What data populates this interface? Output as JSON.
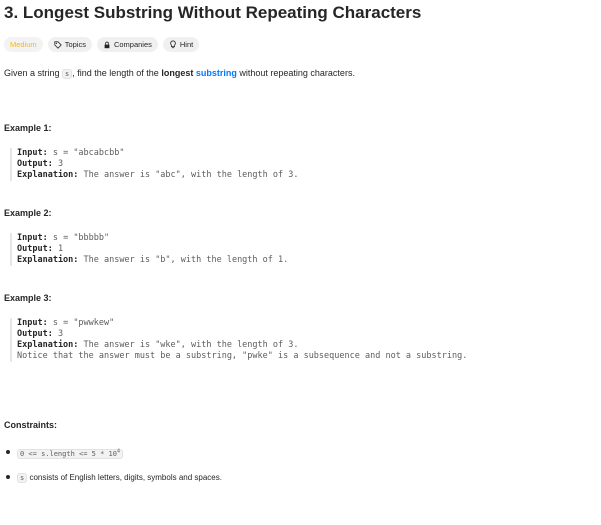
{
  "problem": {
    "title": "3. Longest Substring Without Repeating Characters",
    "tags": {
      "difficulty": "Medium",
      "topics": "Topics",
      "companies": "Companies",
      "hint": "Hint"
    },
    "description": {
      "part1": "Given a string ",
      "code_s": "s",
      "part2": ", find the length of the ",
      "bold": "longest",
      "link": "substring",
      "part3": " without repeating characters."
    }
  },
  "examples": [
    {
      "title": "Example 1:",
      "input_label": "Input:",
      "input_value": "s = \"abcabcbb\"",
      "output_label": "Output:",
      "output_value": "3",
      "explanation_label": "Explanation:",
      "explanation_value": "The answer is \"abc\", with the length of 3."
    },
    {
      "title": "Example 2:",
      "input_label": "Input:",
      "input_value": "s = \"bbbbb\"",
      "output_label": "Output:",
      "output_value": "1",
      "explanation_label": "Explanation:",
      "explanation_value": "The answer is \"b\", with the length of 1."
    },
    {
      "title": "Example 3:",
      "input_label": "Input:",
      "input_value": "s = \"pwwkew\"",
      "output_label": "Output:",
      "output_value": "3",
      "explanation_label": "Explanation:",
      "explanation_value": "The answer is \"wke\", with the length of 3.",
      "note": "Notice that the answer must be a substring, \"pwke\" is a subsequence and not a substring."
    }
  ],
  "constraints": {
    "title": "Constraints:",
    "c1_code": "0 <= s.length <= 5 * 10",
    "c1_exp": "4",
    "c2_code": "s",
    "c2_text": " consists of English letters, digits, symbols and spaces."
  },
  "colors": {
    "medium": "#ffb800",
    "link": "#007aff",
    "text": "#262626"
  }
}
